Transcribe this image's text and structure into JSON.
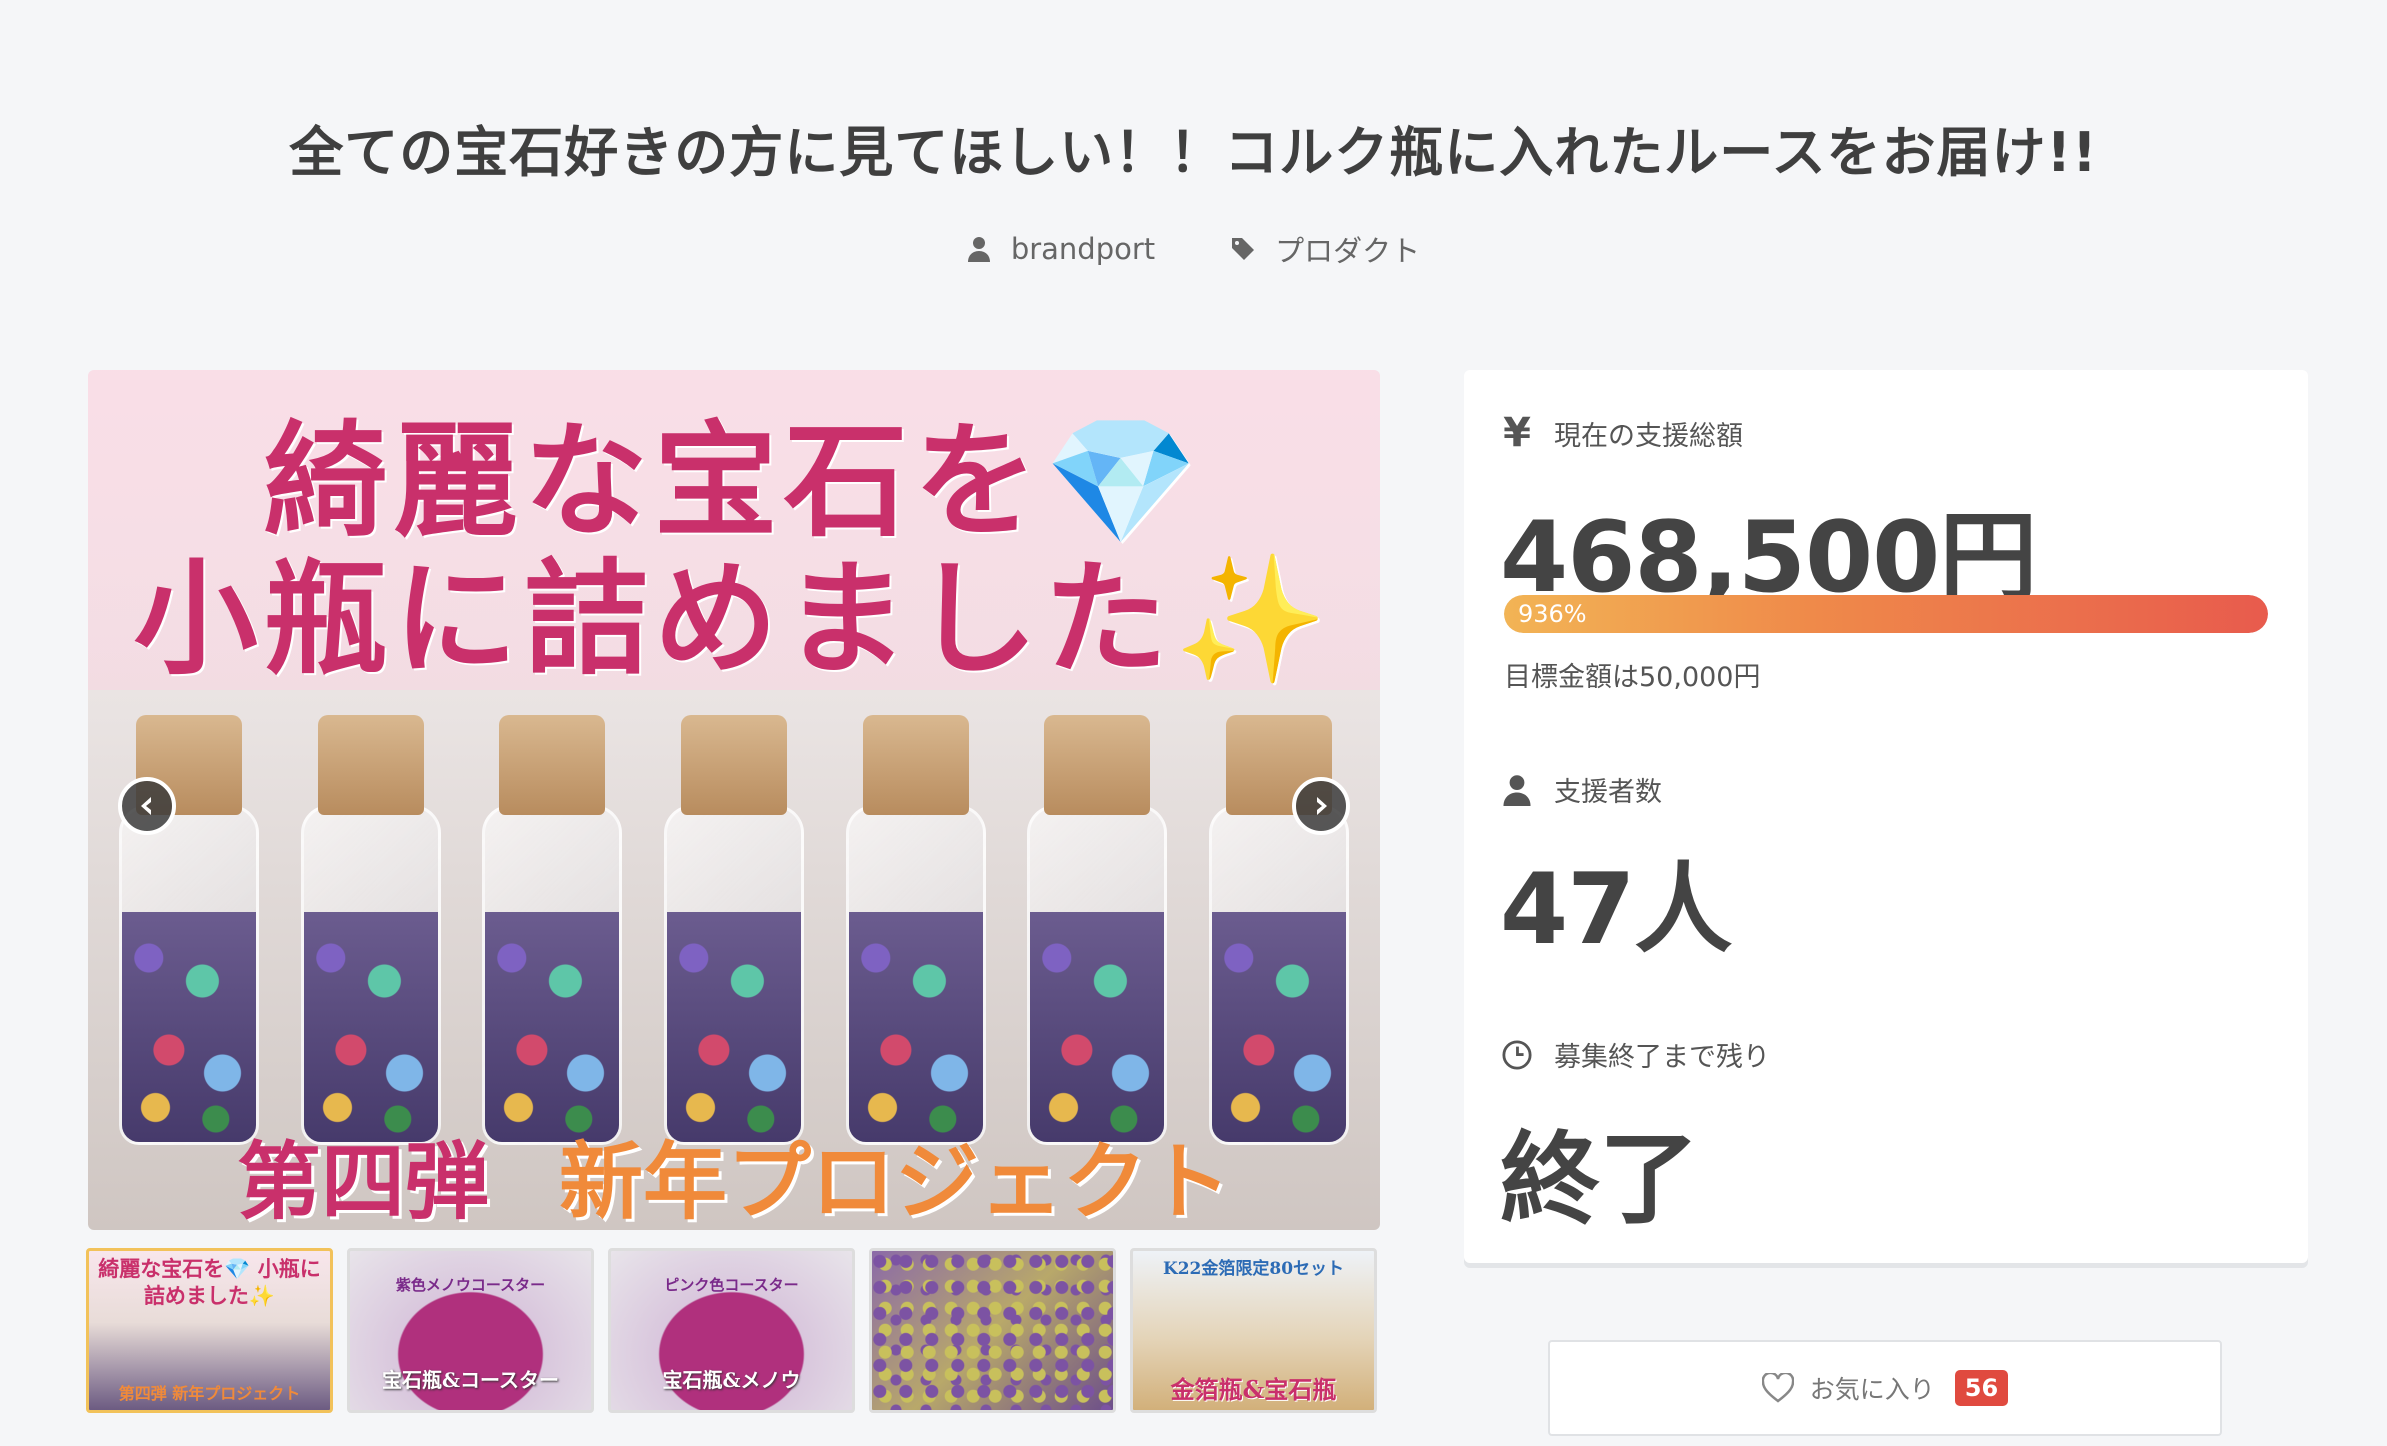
{
  "project": {
    "title": "全ての宝石好きの方に見てほしい！！コルク瓶に入れたルースをお届け!!",
    "owner": "brandport",
    "category": "プロダクト"
  },
  "hero": {
    "line1": "綺麗な宝石を💎",
    "line2": "小瓶に詰めました✨",
    "bottom_left": "第四弾",
    "bottom_right": "新年プロジェクト"
  },
  "thumbnails": [
    {
      "top": "綺麗な宝石を💎 小瓶に詰めました✨",
      "bottom": "第四弾 新年プロジェクト"
    },
    {
      "top": "紫色メノウコースター",
      "bottom": "宝石瓶&コースター"
    },
    {
      "top": "ピンク色コースター",
      "bottom": "宝石瓶&メノウ"
    },
    {
      "top": "",
      "bottom": ""
    },
    {
      "top": "K22金箔限定80セット",
      "bottom": "金箔瓶&宝石瓶"
    }
  ],
  "stats": {
    "amount_label": "現在の支援総額",
    "amount_value": "468,500円",
    "progress_text": "936%",
    "progress_fraction": 1.0,
    "goal_text": "目標金額は50,000円",
    "backers_label": "支援者数",
    "backers_value": "47人",
    "remaining_label": "募集終了まで残り",
    "remaining_value": "終了"
  },
  "favorite": {
    "label": "お気に入り",
    "count": "56"
  },
  "icons": {
    "owner": "user-icon",
    "category": "tag-icon",
    "amount": "yen-icon",
    "backers": "user-icon",
    "remaining": "clock-icon",
    "favorite": "heart-icon",
    "prev": "chevron-left-icon",
    "next": "chevron-right-icon"
  },
  "colors": {
    "progress_start": "#f2b455",
    "progress_end": "#e85b4d",
    "badge": "#e04a3f",
    "hero_pink": "#c9306b",
    "hero_orange": "#f08a3a"
  }
}
